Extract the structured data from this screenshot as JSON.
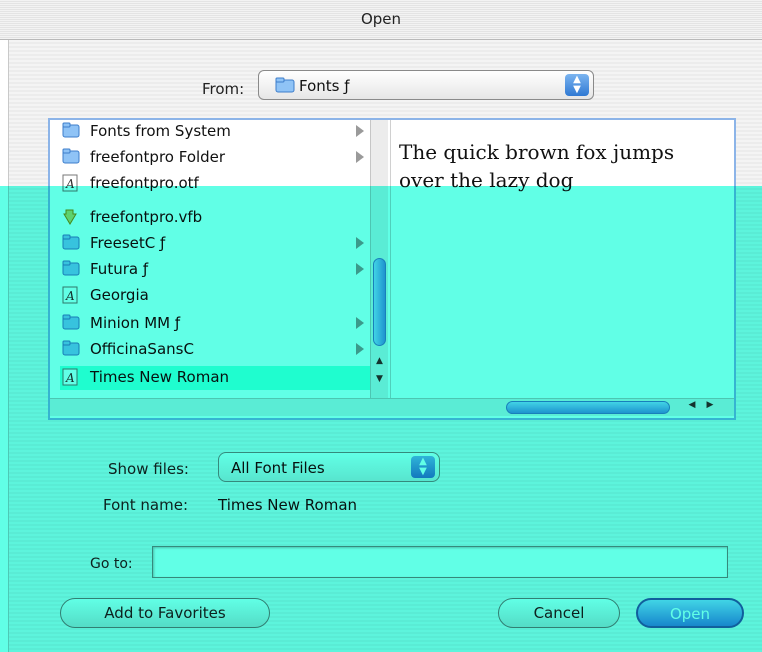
{
  "window": {
    "title": "Open"
  },
  "from": {
    "label": "From:",
    "value": "Fonts ƒ"
  },
  "files": [
    {
      "name": "Fonts from System",
      "icon": "folder-icon",
      "has_children": true
    },
    {
      "name": "freefontpro Folder",
      "icon": "folder-icon",
      "has_children": true
    },
    {
      "name": "freefontpro.otf",
      "icon": "font-file-icon",
      "has_children": false
    },
    {
      "name": "freefontpro.vfb",
      "icon": "document-icon",
      "has_children": false
    },
    {
      "name": "FreesetC ƒ",
      "icon": "folder-icon",
      "has_children": true
    },
    {
      "name": "Futura ƒ",
      "icon": "folder-icon",
      "has_children": true
    },
    {
      "name": "Georgia",
      "icon": "font-file-icon",
      "has_children": false
    },
    {
      "name": "Minion MM ƒ",
      "icon": "folder-icon",
      "has_children": true
    },
    {
      "name": "OfficinaSansC",
      "icon": "folder-icon",
      "has_children": true
    },
    {
      "name": "Times New Roman",
      "icon": "font-file-icon",
      "has_children": false,
      "selected": true
    }
  ],
  "preview": {
    "text": "The quick brown fox jumps over the lazy dog"
  },
  "show_files": {
    "label": "Show files:",
    "value": "All Font Files"
  },
  "font_name": {
    "label": "Font name:",
    "value": "Times New Roman"
  },
  "go_to": {
    "label": "Go to:",
    "value": ""
  },
  "buttons": {
    "favorites": "Add to Favorites",
    "cancel": "Cancel",
    "open": "Open"
  },
  "colors": {
    "accent": "#3b86e3",
    "overlay_tint": "#50fde6"
  }
}
